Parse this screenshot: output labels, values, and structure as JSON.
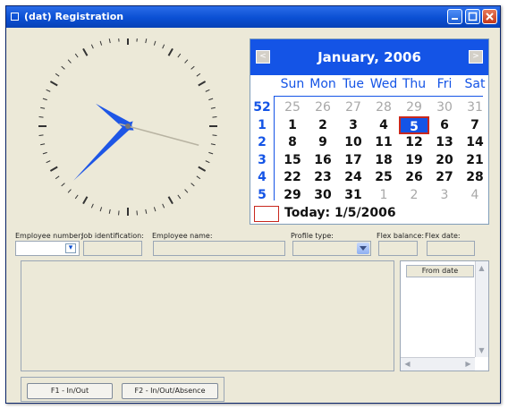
{
  "window": {
    "title": "(dat) Registration"
  },
  "calendar": {
    "month_title": "January, 2006",
    "prev_label": "<",
    "next_label": ">",
    "weekdays": [
      "Sun",
      "Mon",
      "Tue",
      "Wed",
      "Thu",
      "Fri",
      "Sat"
    ],
    "weeks": [
      {
        "week": "52",
        "days": [
          {
            "d": "25",
            "other": true
          },
          {
            "d": "26",
            "other": true
          },
          {
            "d": "27",
            "other": true
          },
          {
            "d": "28",
            "other": true
          },
          {
            "d": "29",
            "other": true
          },
          {
            "d": "30",
            "other": true
          },
          {
            "d": "31",
            "other": true
          }
        ]
      },
      {
        "week": "1",
        "days": [
          {
            "d": "1"
          },
          {
            "d": "2"
          },
          {
            "d": "3"
          },
          {
            "d": "4"
          },
          {
            "d": "5",
            "selected": true
          },
          {
            "d": "6"
          },
          {
            "d": "7"
          }
        ]
      },
      {
        "week": "2",
        "days": [
          {
            "d": "8"
          },
          {
            "d": "9"
          },
          {
            "d": "10"
          },
          {
            "d": "11"
          },
          {
            "d": "12"
          },
          {
            "d": "13"
          },
          {
            "d": "14"
          }
        ]
      },
      {
        "week": "3",
        "days": [
          {
            "d": "15"
          },
          {
            "d": "16"
          },
          {
            "d": "17"
          },
          {
            "d": "18"
          },
          {
            "d": "19"
          },
          {
            "d": "20"
          },
          {
            "d": "21"
          }
        ]
      },
      {
        "week": "4",
        "days": [
          {
            "d": "22"
          },
          {
            "d": "23"
          },
          {
            "d": "24"
          },
          {
            "d": "25"
          },
          {
            "d": "26"
          },
          {
            "d": "27"
          },
          {
            "d": "28"
          }
        ]
      },
      {
        "week": "5",
        "days": [
          {
            "d": "29"
          },
          {
            "d": "30"
          },
          {
            "d": "31"
          },
          {
            "d": "1",
            "other": true
          },
          {
            "d": "2",
            "other": true
          },
          {
            "d": "3",
            "other": true
          },
          {
            "d": "4",
            "other": true
          }
        ]
      }
    ],
    "today_label": "Today: 1/5/2006"
  },
  "form": {
    "employee_number_label": "Employee number:",
    "job_identification_label": "Job identification:",
    "employee_name_label": "Employee name:",
    "profile_type_label": "Profile type:",
    "flex_balance_label": "Flex balance:",
    "flex_date_label": "Flex date:",
    "employee_number_value": "",
    "job_identification_value": "",
    "employee_name_value": "",
    "profile_type_value": "",
    "flex_balance_value": "",
    "flex_date_value": ""
  },
  "side_list": {
    "column_header": "From date"
  },
  "buttons": {
    "f1": "F1 - In/Out",
    "f2": "F2 - In/Out/Absence"
  },
  "colors": {
    "titlebar": "#0a4fd3",
    "calendar_header": "#1454e6",
    "clock_hands": "#1e56e6",
    "selected_day_border": "#c8281e"
  }
}
